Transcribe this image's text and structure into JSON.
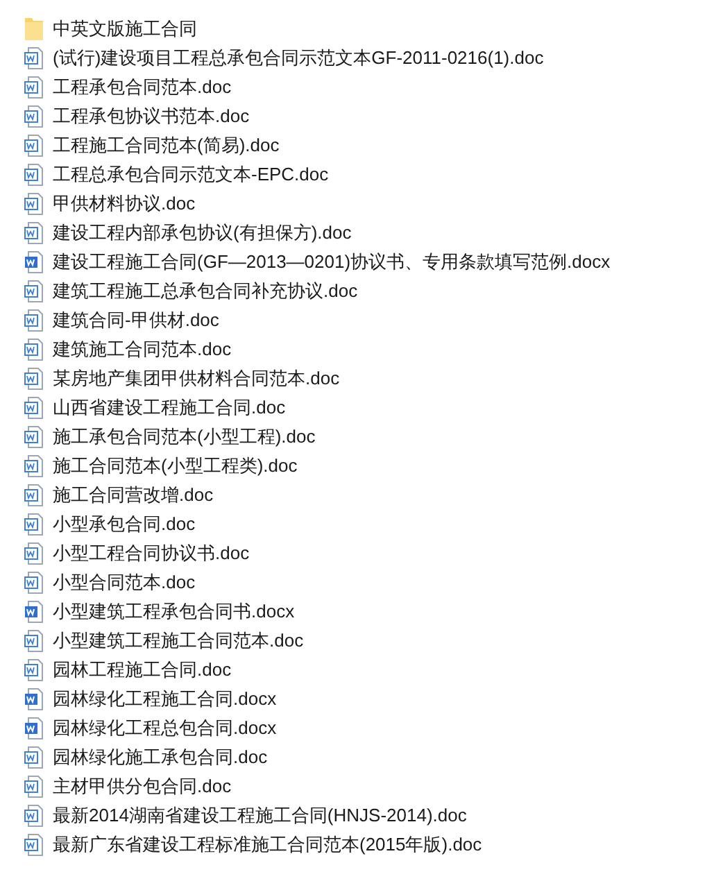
{
  "files": [
    {
      "kind": "folder",
      "name": "中英文版施工合同"
    },
    {
      "kind": "doc",
      "name": "(试行)建设项目工程总承包合同示范文本GF-2011-0216(1).doc"
    },
    {
      "kind": "doc",
      "name": "工程承包合同范本.doc"
    },
    {
      "kind": "doc",
      "name": "工程承包协议书范本.doc"
    },
    {
      "kind": "doc",
      "name": "工程施工合同范本(简易).doc"
    },
    {
      "kind": "doc",
      "name": "工程总承包合同示范文本-EPC.doc"
    },
    {
      "kind": "doc",
      "name": "甲供材料协议.doc"
    },
    {
      "kind": "doc",
      "name": "建设工程内部承包协议(有担保方).doc"
    },
    {
      "kind": "docx",
      "name": "建设工程施工合同(GF—2013—0201)协议书、专用条款填写范例.docx"
    },
    {
      "kind": "doc",
      "name": "建筑工程施工总承包合同补充协议.doc"
    },
    {
      "kind": "doc",
      "name": "建筑合同-甲供材.doc"
    },
    {
      "kind": "doc",
      "name": "建筑施工合同范本.doc"
    },
    {
      "kind": "doc",
      "name": "某房地产集团甲供材料合同范本.doc"
    },
    {
      "kind": "doc",
      "name": "山西省建设工程施工合同.doc"
    },
    {
      "kind": "doc",
      "name": "施工承包合同范本(小型工程).doc"
    },
    {
      "kind": "doc",
      "name": "施工合同范本(小型工程类).doc"
    },
    {
      "kind": "doc",
      "name": "施工合同营改增.doc"
    },
    {
      "kind": "doc",
      "name": "小型承包合同.doc"
    },
    {
      "kind": "doc",
      "name": "小型工程合同协议书.doc"
    },
    {
      "kind": "doc",
      "name": "小型合同范本.doc"
    },
    {
      "kind": "docx",
      "name": "小型建筑工程承包合同书.docx"
    },
    {
      "kind": "doc",
      "name": "小型建筑工程施工合同范本.doc"
    },
    {
      "kind": "doc",
      "name": "园林工程施工合同.doc"
    },
    {
      "kind": "docx",
      "name": "园林绿化工程施工合同.docx"
    },
    {
      "kind": "docx",
      "name": "园林绿化工程总包合同.docx"
    },
    {
      "kind": "doc",
      "name": "园林绿化施工承包合同.doc"
    },
    {
      "kind": "doc",
      "name": "主材甲供分包合同.doc"
    },
    {
      "kind": "doc",
      "name": "最新2014湖南省建设工程施工合同(HNJS-2014).doc"
    },
    {
      "kind": "doc",
      "name": "最新广东省建设工程标准施工合同范本(2015年版).doc"
    }
  ]
}
